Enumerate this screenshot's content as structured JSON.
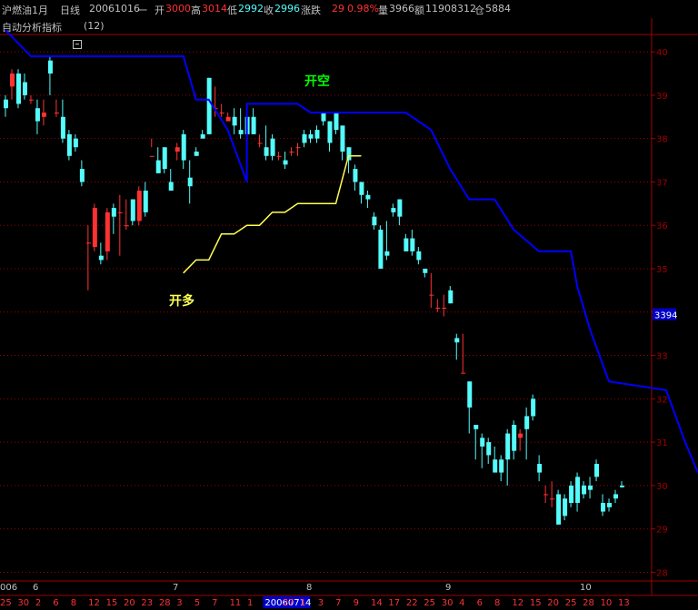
{
  "header": {
    "instrument": "沪燃油1月",
    "period": "日线",
    "date": "20061016",
    "weekday": "一",
    "open_label": "开",
    "open": "3000",
    "high_label": "高",
    "high": "3014",
    "low_label": "低",
    "low": "2992",
    "close_label": "收",
    "close": "2996",
    "change_label": "涨跌",
    "change": "29",
    "change_pct": "0.98%",
    "volume_label": "量",
    "volume": "3966",
    "amount_label": "额",
    "amount": "11908312",
    "oi_label": "仓",
    "oi": "5884"
  },
  "indicator": {
    "name": "自动分析指标",
    "param": "(12)"
  },
  "colors": {
    "up": "#ff3232",
    "down": "#54fcfc",
    "stop_short": "#0000ff",
    "stop_long": "#ffff54",
    "axis": "#a00000",
    "open_short_label": "#00ff00",
    "open_long_label": "#ffff54"
  },
  "chart_data": {
    "type": "candlestick",
    "ylim": [
      27.8,
      40.4
    ],
    "y_ticks": [
      28,
      29,
      30,
      31,
      32,
      33,
      34,
      35,
      36,
      37,
      38,
      39,
      40
    ],
    "cursor_price": "3394",
    "cursor_date": "20060714",
    "x_day_labels": [
      "25",
      "30",
      "2",
      "6",
      "8",
      "12",
      "15",
      "20",
      "23",
      "28",
      "3",
      "5",
      "7",
      "11",
      "1",
      "20060714",
      "27",
      "1",
      "3",
      "7",
      "9",
      "14",
      "17",
      "22",
      "25",
      "30",
      "4",
      "6",
      "8",
      "12",
      "15",
      "20",
      "25",
      "28",
      "10",
      "13"
    ],
    "month_labels": [
      "006",
      "6",
      "7",
      "8",
      "9",
      "10"
    ],
    "annotations": [
      {
        "text": "开空",
        "color": "#00ff00"
      },
      {
        "text": "开多",
        "color": "#ffff54"
      }
    ],
    "candles": [
      [
        38.9,
        39.0,
        38.5,
        38.7
      ],
      [
        39.2,
        39.6,
        38.9,
        39.5
      ],
      [
        39.5,
        39.6,
        38.7,
        38.8
      ],
      [
        39.3,
        39.5,
        38.9,
        39.0
      ],
      [
        38.9,
        39.0,
        38.8,
        38.9
      ],
      [
        38.7,
        38.9,
        38.1,
        38.4
      ],
      [
        38.5,
        38.9,
        38.3,
        38.6
      ],
      [
        39.8,
        39.9,
        39.0,
        39.5
      ],
      [
        38.6,
        38.9,
        38.5,
        38.6
      ],
      [
        38.5,
        38.9,
        37.9,
        38.0
      ],
      [
        38.1,
        38.2,
        37.5,
        37.6
      ],
      [
        38.0,
        38.1,
        37.7,
        37.8
      ],
      [
        37.3,
        37.5,
        36.9,
        37.0
      ],
      [
        35.6,
        36.0,
        34.5,
        35.6
      ],
      [
        35.5,
        36.5,
        35.4,
        36.4
      ],
      [
        35.3,
        35.6,
        35.1,
        35.2
      ],
      [
        35.4,
        36.4,
        35.2,
        36.3
      ],
      [
        36.4,
        36.5,
        35.8,
        36.2
      ],
      [
        36.3,
        36.7,
        35.3,
        36.3
      ],
      [
        36.0,
        36.6,
        35.9,
        36.0
      ],
      [
        36.6,
        36.6,
        36.0,
        36.1
      ],
      [
        36.1,
        36.9,
        36.0,
        36.8
      ],
      [
        36.8,
        37.0,
        36.2,
        36.3
      ],
      [
        37.6,
        38.0,
        37.8,
        37.6
      ],
      [
        37.5,
        37.8,
        37.2,
        37.2
      ],
      [
        37.8,
        37.8,
        37.2,
        37.3
      ],
      [
        37.0,
        37.3,
        36.8,
        36.8
      ],
      [
        37.7,
        37.9,
        37.5,
        37.8
      ],
      [
        38.1,
        38.2,
        37.3,
        37.5
      ],
      [
        37.1,
        37.5,
        36.5,
        36.9
      ],
      [
        37.7,
        37.8,
        37.6,
        37.6
      ],
      [
        38.1,
        38.2,
        38.0,
        38.0
      ],
      [
        39.4,
        39.4,
        38.1,
        38.1
      ],
      [
        38.7,
        39.2,
        38.5,
        38.7
      ],
      [
        38.6,
        38.8,
        38.5,
        38.6
      ],
      [
        38.4,
        38.6,
        38.4,
        38.5
      ],
      [
        38.5,
        38.7,
        38.1,
        38.3
      ],
      [
        38.2,
        38.7,
        38.0,
        38.1
      ],
      [
        38.5,
        38.6,
        38.1,
        38.1
      ],
      [
        38.5,
        38.7,
        38.1,
        38.1
      ],
      [
        37.9,
        38.1,
        37.8,
        37.9
      ],
      [
        37.8,
        38.3,
        37.5,
        37.6
      ],
      [
        38.0,
        38.1,
        37.5,
        37.6
      ],
      [
        37.6,
        37.7,
        37.5,
        37.6
      ],
      [
        37.5,
        37.7,
        37.3,
        37.4
      ],
      [
        37.7,
        37.8,
        37.6,
        37.7
      ],
      [
        37.8,
        37.9,
        37.6,
        37.8
      ],
      [
        38.1,
        38.2,
        37.8,
        37.9
      ],
      [
        38.1,
        38.2,
        37.9,
        38.0
      ],
      [
        38.2,
        38.3,
        37.9,
        38.0
      ],
      [
        38.6,
        38.6,
        38.3,
        38.4
      ],
      [
        38.4,
        38.4,
        37.7,
        37.9
      ],
      [
        38.6,
        38.6,
        38.1,
        38.2
      ],
      [
        38.3,
        38.3,
        37.5,
        37.7
      ],
      [
        37.8,
        37.8,
        37.2,
        37.5
      ],
      [
        37.3,
        37.4,
        36.8,
        37.0
      ],
      [
        37.0,
        37.0,
        36.5,
        36.7
      ],
      [
        36.7,
        36.8,
        36.4,
        36.6
      ],
      [
        36.2,
        36.3,
        35.9,
        36.0
      ],
      [
        35.9,
        36.0,
        35.0,
        35.0
      ],
      [
        35.4,
        36.1,
        35.2,
        35.3
      ],
      [
        36.4,
        36.5,
        36.2,
        36.3
      ],
      [
        36.6,
        36.6,
        36.0,
        36.2
      ],
      [
        35.7,
        35.8,
        35.4,
        35.4
      ],
      [
        35.7,
        35.9,
        35.3,
        35.4
      ],
      [
        35.4,
        35.5,
        35.1,
        35.2
      ],
      [
        35.0,
        35.0,
        34.8,
        34.9
      ],
      [
        34.4,
        34.9,
        34.1,
        34.4
      ],
      [
        34.1,
        34.3,
        34.0,
        34.1
      ],
      [
        34.1,
        34.4,
        33.9,
        34.1
      ],
      [
        34.5,
        34.6,
        34.2,
        34.2
      ],
      [
        33.4,
        33.5,
        32.9,
        33.3
      ],
      [
        32.6,
        33.5,
        32.6,
        32.6
      ],
      [
        32.4,
        32.4,
        31.2,
        31.8
      ],
      [
        31.4,
        31.4,
        30.6,
        31.3
      ],
      [
        31.1,
        31.2,
        30.4,
        30.9
      ],
      [
        31.0,
        31.1,
        30.5,
        30.7
      ],
      [
        30.6,
        30.9,
        30.3,
        30.3
      ],
      [
        30.6,
        30.7,
        30.1,
        30.3
      ],
      [
        31.2,
        31.3,
        30.0,
        30.6
      ],
      [
        31.4,
        31.5,
        30.6,
        30.8
      ],
      [
        31.1,
        31.3,
        30.8,
        31.2
      ],
      [
        31.6,
        31.8,
        30.6,
        31.3
      ],
      [
        32.0,
        32.1,
        31.5,
        31.6
      ],
      [
        30.5,
        30.7,
        30.1,
        30.3
      ],
      [
        29.8,
        30.0,
        29.6,
        29.8
      ],
      [
        29.7,
        30.1,
        29.5,
        29.7
      ],
      [
        29.8,
        29.9,
        29.1,
        29.1
      ],
      [
        29.7,
        29.8,
        29.2,
        29.3
      ],
      [
        30.0,
        30.1,
        29.5,
        29.6
      ],
      [
        30.2,
        30.3,
        29.4,
        29.6
      ],
      [
        30.0,
        30.1,
        29.7,
        29.8
      ],
      [
        30.0,
        30.2,
        29.7,
        29.9
      ],
      [
        30.5,
        30.6,
        30.1,
        30.2
      ],
      [
        29.6,
        29.8,
        29.3,
        29.4
      ],
      [
        29.6,
        29.7,
        29.4,
        29.5
      ],
      [
        29.8,
        29.9,
        29.6,
        29.7
      ],
      [
        30.0,
        30.1,
        29.95,
        29.96
      ]
    ],
    "stop_short": [
      [
        0,
        40.5
      ],
      [
        4,
        39.9
      ],
      [
        28,
        39.9
      ],
      [
        30,
        38.9
      ],
      [
        32,
        38.9
      ],
      [
        35,
        38.2
      ],
      [
        38,
        37.0
      ],
      [
        38,
        38.8
      ],
      [
        45,
        38.8
      ],
      [
        46,
        38.8
      ],
      [
        48,
        38.6
      ],
      [
        63,
        38.6
      ],
      [
        67,
        38.2
      ],
      [
        70,
        37.3
      ],
      [
        73,
        36.6
      ],
      [
        77,
        36.6
      ],
      [
        80,
        35.9
      ],
      [
        84,
        35.4
      ],
      [
        89,
        35.4
      ],
      [
        90,
        34.6
      ],
      [
        92,
        33.6
      ],
      [
        95,
        32.4
      ],
      [
        104,
        32.2
      ],
      [
        107,
        31.0
      ],
      [
        109,
        30.3
      ],
      [
        110,
        30.3
      ]
    ],
    "stop_long": [
      [
        28,
        34.9
      ],
      [
        30,
        35.2
      ],
      [
        32,
        35.2
      ],
      [
        34,
        35.8
      ],
      [
        36,
        35.8
      ],
      [
        38,
        36.0
      ],
      [
        40,
        36.0
      ],
      [
        42,
        36.3
      ],
      [
        44,
        36.3
      ],
      [
        46,
        36.5
      ],
      [
        52,
        36.5
      ],
      [
        54,
        37.6
      ],
      [
        56,
        37.6
      ]
    ]
  }
}
